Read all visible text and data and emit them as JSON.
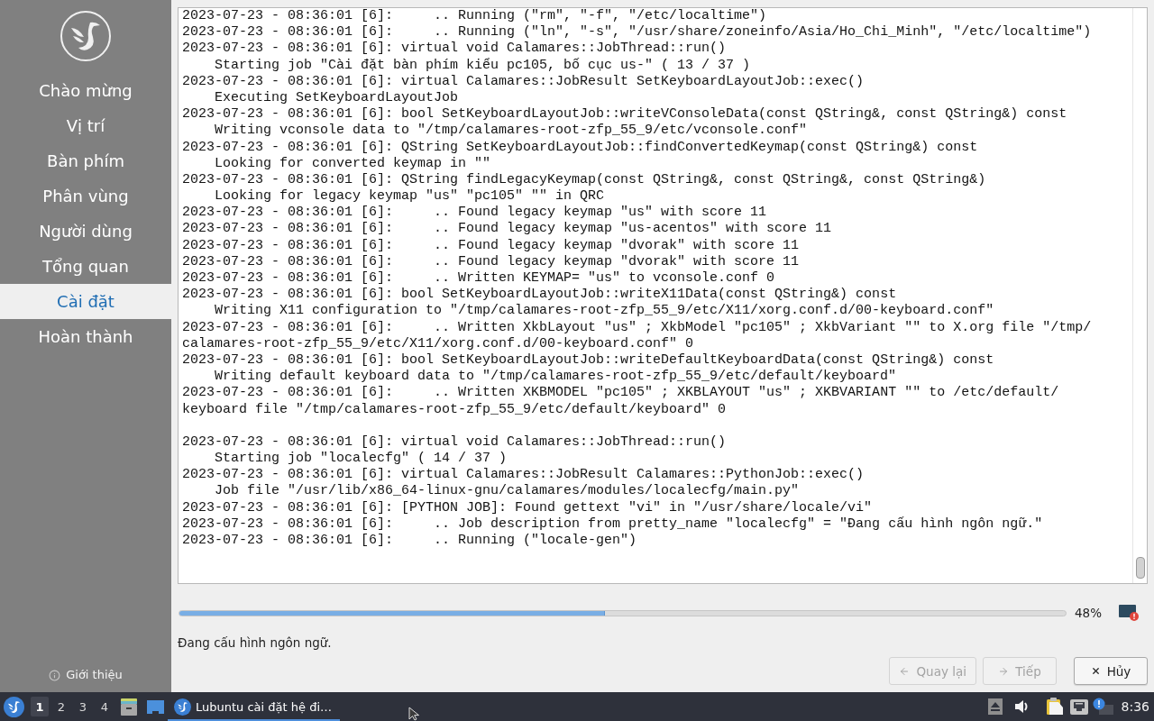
{
  "sidebar": {
    "items": [
      {
        "label": "Chào mừng",
        "selected": false
      },
      {
        "label": "Vị trí",
        "selected": false
      },
      {
        "label": "Bàn phím",
        "selected": false
      },
      {
        "label": "Phân vùng",
        "selected": false
      },
      {
        "label": "Người dùng",
        "selected": false
      },
      {
        "label": "Tổng quan",
        "selected": false
      },
      {
        "label": "Cài đặt",
        "selected": true
      },
      {
        "label": "Hoàn thành",
        "selected": false
      }
    ],
    "about_button": {
      "label": "Giới thiệu"
    }
  },
  "log": {
    "lines": [
      {
        "kind": "line",
        "text": "2023-07-23 - 08:36:01 [6]:     .. Running (\"rm\", \"-f\", \"/etc/localtime\")"
      },
      {
        "kind": "line",
        "text": "2023-07-23 - 08:36:01 [6]:     .. Running (\"ln\", \"-s\", \"/usr/share/zoneinfo/Asia/Ho_Chi_Minh\", \"/etc/localtime\")"
      },
      {
        "kind": "line",
        "text": "2023-07-23 - 08:36:01 [6]: virtual void Calamares::JobThread::run()"
      },
      {
        "kind": "indented",
        "text": "Starting job \"Cài đặt bàn phím kiểu pc105, bố cục us-\" ( 13 / 37 )"
      },
      {
        "kind": "line",
        "text": "2023-07-23 - 08:36:01 [6]: virtual Calamares::JobResult SetKeyboardLayoutJob::exec()"
      },
      {
        "kind": "indented",
        "text": "Executing SetKeyboardLayoutJob"
      },
      {
        "kind": "line",
        "text": "2023-07-23 - 08:36:01 [6]: bool SetKeyboardLayoutJob::writeVConsoleData(const QString&, const QString&) const"
      },
      {
        "kind": "indented",
        "text": "Writing vconsole data to \"/tmp/calamares-root-zfp_55_9/etc/vconsole.conf\""
      },
      {
        "kind": "line",
        "text": "2023-07-23 - 08:36:01 [6]: QString SetKeyboardLayoutJob::findConvertedKeymap(const QString&) const"
      },
      {
        "kind": "indented",
        "text": "Looking for converted keymap in \"\""
      },
      {
        "kind": "line",
        "text": "2023-07-23 - 08:36:01 [6]: QString findLegacyKeymap(const QString&, const QString&, const QString&)"
      },
      {
        "kind": "indented",
        "text": "Looking for legacy keymap \"us\" \"pc105\" \"\" in QRC"
      },
      {
        "kind": "line",
        "text": "2023-07-23 - 08:36:01 [6]:     .. Found legacy keymap \"us\" with score 11"
      },
      {
        "kind": "line",
        "text": "2023-07-23 - 08:36:01 [6]:     .. Found legacy keymap \"us-acentos\" with score 11"
      },
      {
        "kind": "line",
        "text": "2023-07-23 - 08:36:01 [6]:     .. Found legacy keymap \"dvorak\" with score 11"
      },
      {
        "kind": "line",
        "text": "2023-07-23 - 08:36:01 [6]:     .. Found legacy keymap \"dvorak\" with score 11"
      },
      {
        "kind": "line",
        "text": "2023-07-23 - 08:36:01 [6]:     .. Written KEYMAP= \"us\" to vconsole.conf 0"
      },
      {
        "kind": "line",
        "text": "2023-07-23 - 08:36:01 [6]: bool SetKeyboardLayoutJob::writeX11Data(const QString&) const"
      },
      {
        "kind": "indented",
        "text": "Writing X11 configuration to \"/tmp/calamares-root-zfp_55_9/etc/X11/xorg.conf.d/00-keyboard.conf\""
      },
      {
        "kind": "line",
        "text": "2023-07-23 - 08:36:01 [6]:     .. Written XkbLayout \"us\" ; XkbModel \"pc105\" ; XkbVariant \"\" to X.org file \"/tmp/"
      },
      {
        "kind": "line",
        "text": "calamares-root-zfp_55_9/etc/X11/xorg.conf.d/00-keyboard.conf\" 0"
      },
      {
        "kind": "line",
        "text": "2023-07-23 - 08:36:01 [6]: bool SetKeyboardLayoutJob::writeDefaultKeyboardData(const QString&) const"
      },
      {
        "kind": "indented",
        "text": "Writing default keyboard data to \"/tmp/calamares-root-zfp_55_9/etc/default/keyboard\""
      },
      {
        "kind": "line",
        "text": "2023-07-23 - 08:36:01 [6]:     .. Written XKBMODEL \"pc105\" ; XKBLAYOUT \"us\" ; XKBVARIANT \"\" to /etc/default/"
      },
      {
        "kind": "line",
        "text": "keyboard file \"/tmp/calamares-root-zfp_55_9/etc/default/keyboard\" 0"
      },
      {
        "kind": "blank"
      },
      {
        "kind": "line",
        "text": "2023-07-23 - 08:36:01 [6]: virtual void Calamares::JobThread::run()"
      },
      {
        "kind": "indented",
        "text": "Starting job \"localecfg\" ( 14 / 37 )"
      },
      {
        "kind": "line",
        "text": "2023-07-23 - 08:36:01 [6]: virtual Calamares::JobResult Calamares::PythonJob::exec()"
      },
      {
        "kind": "indented",
        "text": "Job file \"/usr/lib/x86_64-linux-gnu/calamares/modules/localecfg/main.py\""
      },
      {
        "kind": "line",
        "text": "2023-07-23 - 08:36:01 [6]: [PYTHON JOB]: Found gettext \"vi\" in \"/usr/share/locale/vi\""
      },
      {
        "kind": "line",
        "text": "2023-07-23 - 08:36:01 [6]:     .. Job description from pretty_name \"localecfg\" = \"Đang cấu hình ngôn ngữ.\""
      },
      {
        "kind": "line",
        "text": "2023-07-23 - 08:36:01 [6]:     .. Running (\"locale-gen\")"
      }
    ]
  },
  "progress": {
    "level": 0.48,
    "reading": "48%"
  },
  "status": {
    "text": "Đang cấu hình ngôn ngữ."
  },
  "buttons": [
    {
      "kind": "back",
      "label": "Quay lại",
      "disabled": true
    },
    {
      "kind": "next",
      "label": "Tiếp",
      "disabled": true
    },
    {
      "kind": "cancel",
      "label": "Hủy",
      "disabled": false
    }
  ],
  "taskbar": {
    "desktops": [
      {
        "label": "1",
        "selected": true
      },
      {
        "label": "2",
        "selected": false
      },
      {
        "label": "3",
        "selected": false
      },
      {
        "label": "4",
        "selected": false
      }
    ],
    "task": {
      "label": "Lubuntu cài đặt hệ đi…",
      "active": true
    },
    "clock": "8:36"
  }
}
